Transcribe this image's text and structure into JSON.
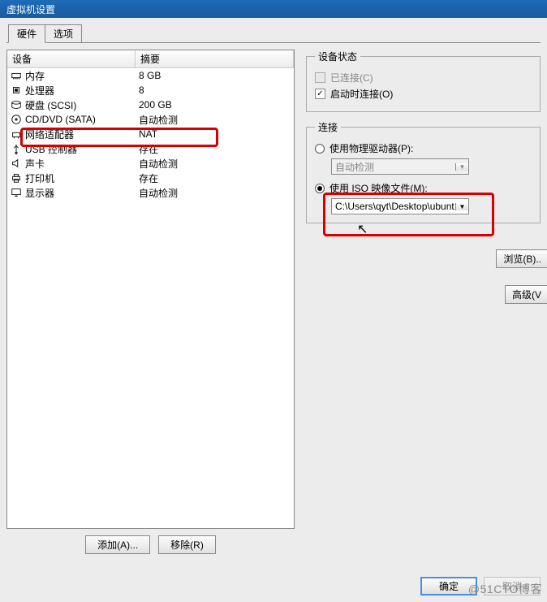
{
  "window": {
    "title": "虚拟机设置"
  },
  "tabs": {
    "hardware": "硬件",
    "options": "选项"
  },
  "columns": {
    "device": "设备",
    "summary": "摘要"
  },
  "hardware": [
    {
      "icon": "memory",
      "name": "内存",
      "summary": "8 GB"
    },
    {
      "icon": "cpu",
      "name": "处理器",
      "summary": "8"
    },
    {
      "icon": "disk",
      "name": "硬盘 (SCSI)",
      "summary": "200 GB"
    },
    {
      "icon": "cd",
      "name": "CD/DVD (SATA)",
      "summary": "自动检测"
    },
    {
      "icon": "net",
      "name": "网络适配器",
      "summary": "NAT"
    },
    {
      "icon": "usb",
      "name": "USB 控制器",
      "summary": "存在"
    },
    {
      "icon": "sound",
      "name": "声卡",
      "summary": "自动检测"
    },
    {
      "icon": "printer",
      "name": "打印机",
      "summary": "存在"
    },
    {
      "icon": "display",
      "name": "显示器",
      "summary": "自动检测"
    }
  ],
  "buttons": {
    "add": "添加(A)...",
    "remove": "移除(R)",
    "ok": "确定",
    "cancel": "取消",
    "browse": "浏览(B)..",
    "advanced": "高级(V"
  },
  "status": {
    "legend": "设备状态",
    "connected": "已连接(C)",
    "connect_at_power": "启动时连接(O)"
  },
  "connection": {
    "legend": "连接",
    "physical": "使用物理驱动器(P):",
    "physical_value": "自动检测",
    "iso": "使用 ISO 映像文件(M):",
    "iso_value": "C:\\Users\\qyt\\Desktop\\ubunt"
  },
  "watermark": "@51CTO博客"
}
